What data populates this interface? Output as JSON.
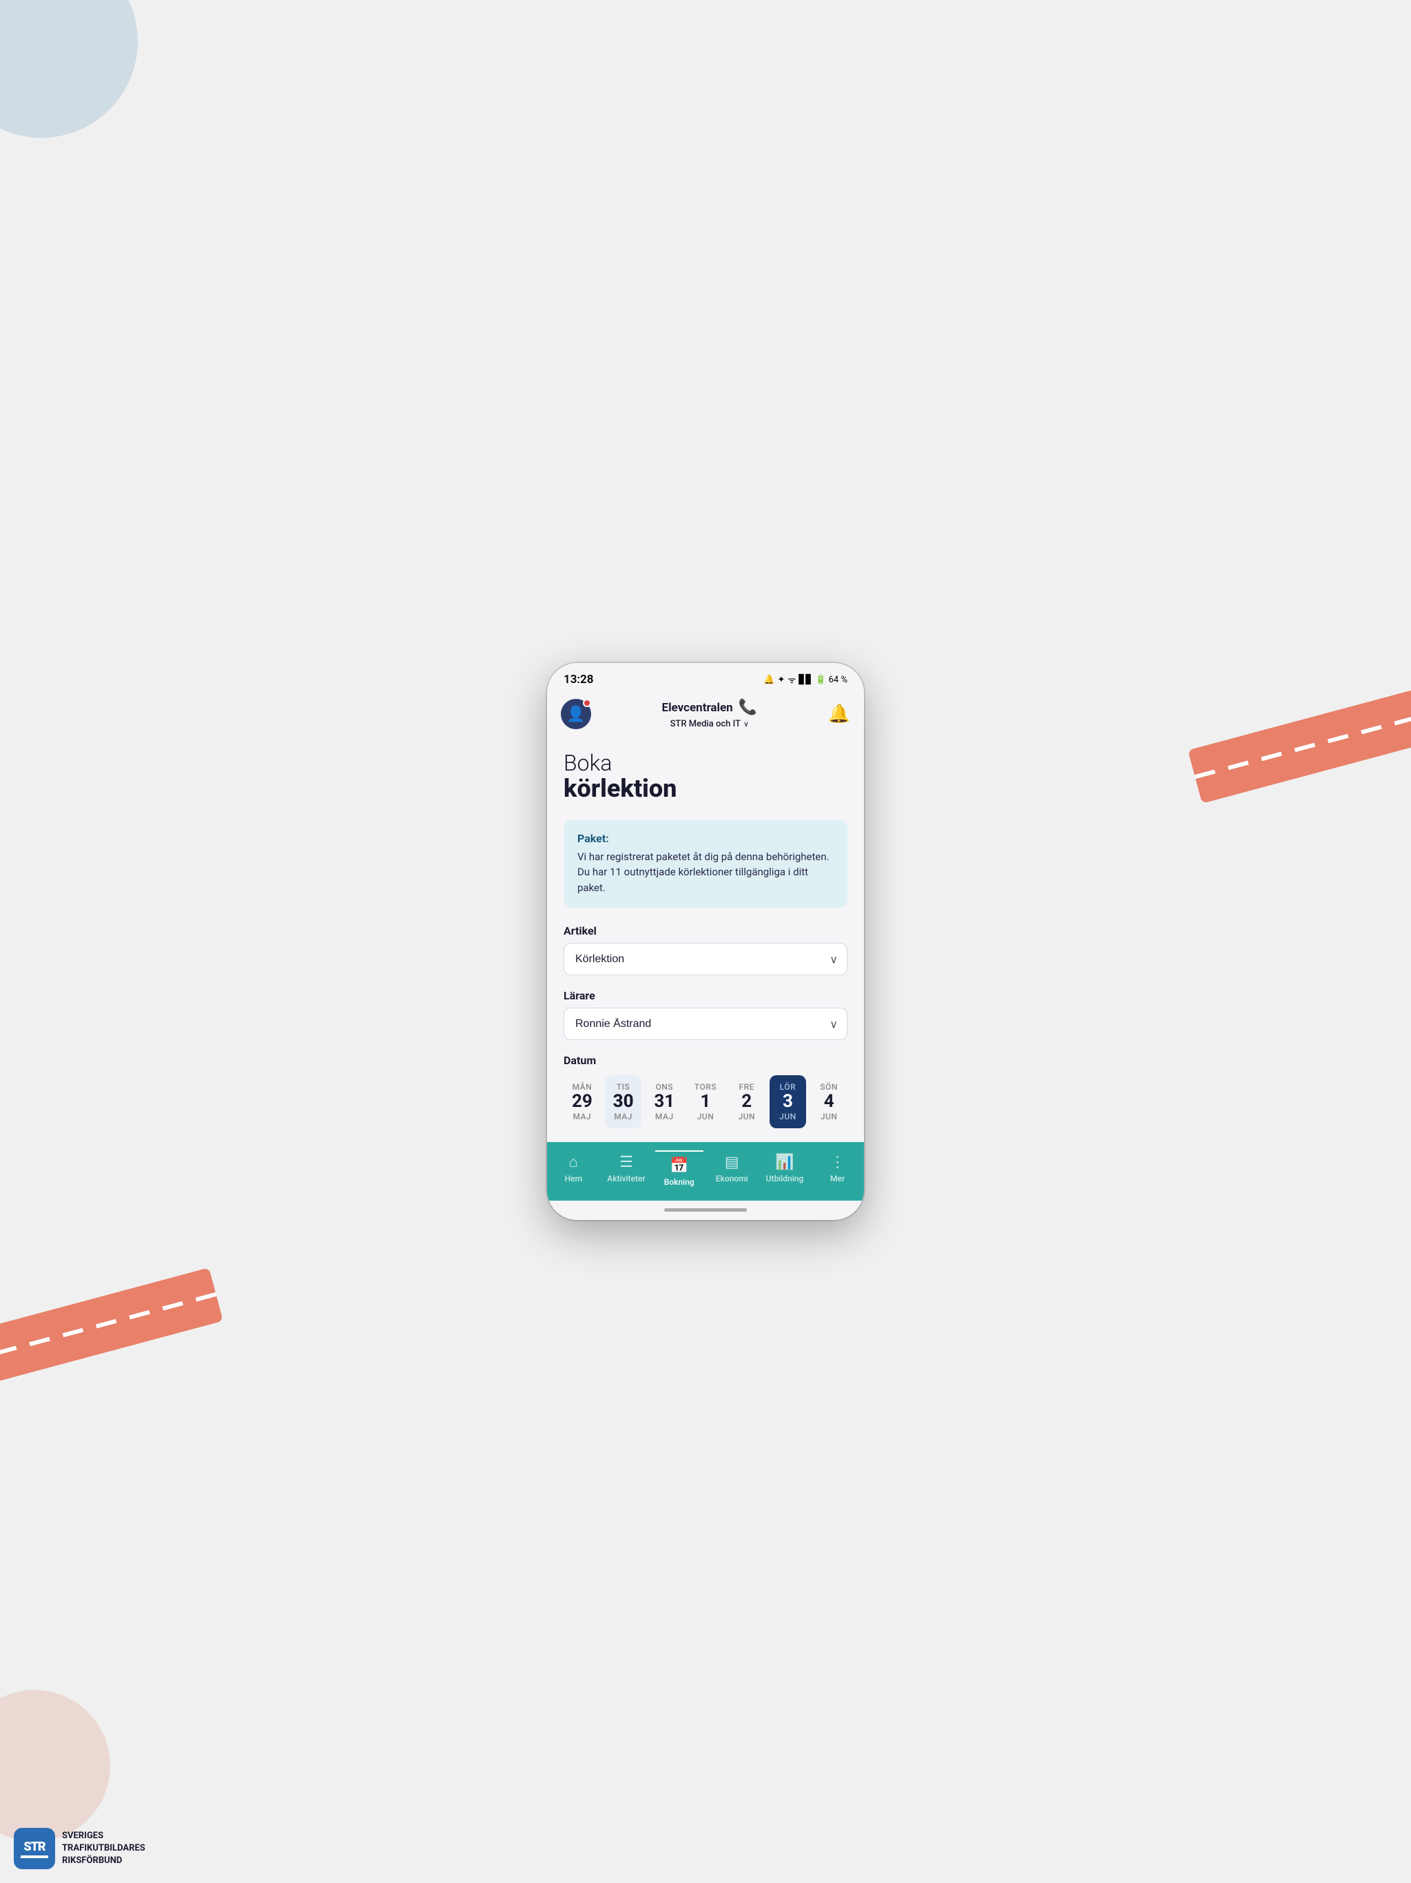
{
  "background": {
    "colors": {
      "page_bg": "#f0f0f0",
      "road_color": "#e8806a",
      "circle_top": "#b0c8d8",
      "circle_bottom": "#e8c8c0"
    }
  },
  "status_bar": {
    "time": "13:28",
    "icons": "🔔 ✦ ᯤ  ▊▊ 🔋 64 %"
  },
  "header": {
    "app_name": "Elevcentralen",
    "subtitle": "STR Media och IT",
    "chevron": "∨"
  },
  "page": {
    "title_line1": "Boka",
    "title_line2": "körlektion"
  },
  "info_box": {
    "label": "Paket:",
    "text": "Vi har registrerat paketet åt dig på denna behörigheten. Du har 11 outnyttjade körlektioner tillgängliga i ditt paket."
  },
  "artikel": {
    "label": "Artikel",
    "selected": "Körlektion",
    "options": [
      "Körlektion"
    ]
  },
  "larare": {
    "label": "Lärare",
    "selected": "Ronnie Åstrand",
    "options": [
      "Ronnie Åstrand"
    ]
  },
  "datum": {
    "label": "Datum",
    "days": [
      {
        "day_name": "MÅN",
        "day_num": "29",
        "month": "MAJ",
        "state": "normal"
      },
      {
        "day_name": "TIS",
        "day_num": "30",
        "month": "MAJ",
        "state": "highlighted"
      },
      {
        "day_name": "ONS",
        "day_num": "31",
        "month": "MAJ",
        "state": "normal"
      },
      {
        "day_name": "TORS",
        "day_num": "1",
        "month": "JUN",
        "state": "normal"
      },
      {
        "day_name": "FRE",
        "day_num": "2",
        "month": "JUN",
        "state": "normal"
      },
      {
        "day_name": "LÖR",
        "day_num": "3",
        "month": "JUN",
        "state": "selected"
      },
      {
        "day_name": "SÖN",
        "day_num": "4",
        "month": "JUN",
        "state": "normal"
      }
    ]
  },
  "bottom_nav": {
    "items": [
      {
        "icon": "⌂",
        "label": "Hem",
        "active": false
      },
      {
        "icon": "☰",
        "label": "Aktiviteter",
        "active": false
      },
      {
        "icon": "📅",
        "label": "Bokning",
        "active": true
      },
      {
        "icon": "▤",
        "label": "Ekonomi",
        "active": false
      },
      {
        "icon": "📊",
        "label": "Utbildning",
        "active": false
      },
      {
        "icon": "⋮",
        "label": "Mer",
        "active": false
      }
    ]
  },
  "brand": {
    "logo_text": "STR",
    "name_line1": "SVERIGES",
    "name_line2": "TRAFIKUTBILDARES",
    "name_line3": "RIKSFÖRBUND"
  }
}
